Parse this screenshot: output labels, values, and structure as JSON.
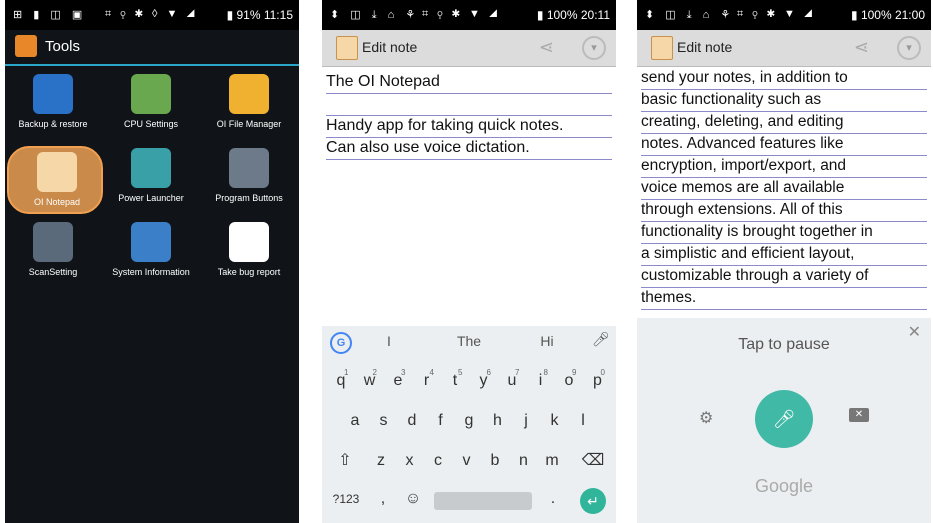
{
  "phone1": {
    "status": {
      "left_icons": "⊞ ▮ ◫ ▣",
      "mid_icons": "⌗ ⚲ ✱ ◊ ▼ ◢",
      "right": "▮ 91% 11:15"
    },
    "header_title": "Tools",
    "apps": [
      {
        "label": "Backup & restore",
        "color": "#2a71c8",
        "icon": "backup-restore-icon"
      },
      {
        "label": "CPU Settings",
        "color": "#6aa84f",
        "icon": "cpu-icon"
      },
      {
        "label": "OI File Manager",
        "color": "#f0b030",
        "icon": "folder-icon"
      },
      {
        "label": "OI Notepad",
        "color": "#f5d7a8",
        "icon": "notepad-icon",
        "selected": true
      },
      {
        "label": "Power Launcher",
        "color": "#3aa0a8",
        "icon": "power-launcher-icon"
      },
      {
        "label": "Program Buttons",
        "color": "#6c7a8a",
        "icon": "program-buttons-icon"
      },
      {
        "label": "ScanSetting",
        "color": "#5a6a7a",
        "icon": "scan-setting-icon"
      },
      {
        "label": "System Information",
        "color": "#3b7fc8",
        "icon": "info-icon"
      },
      {
        "label": "Take bug report",
        "color": "#ffffff",
        "icon": "bug-report-icon"
      }
    ]
  },
  "phone2": {
    "status": {
      "left_icons": "⬍ ◫ ⤓ ⌂ ⚘",
      "mid_icons": "⌗ ⚲ ✱ ▼ ◢",
      "right": "▮ 100% 20:11"
    },
    "header_title": "Edit note",
    "lines": [
      "The OI Notepad",
      "",
      "Handy app for taking quick notes.",
      "Can also use voice dictation."
    ],
    "suggestions": [
      "I",
      "The",
      "Hi"
    ],
    "row1": [
      {
        "k": "q",
        "n": "1"
      },
      {
        "k": "w",
        "n": "2"
      },
      {
        "k": "e",
        "n": "3"
      },
      {
        "k": "r",
        "n": "4"
      },
      {
        "k": "t",
        "n": "5"
      },
      {
        "k": "y",
        "n": "6"
      },
      {
        "k": "u",
        "n": "7"
      },
      {
        "k": "i",
        "n": "8"
      },
      {
        "k": "o",
        "n": "9"
      },
      {
        "k": "p",
        "n": "0"
      }
    ],
    "row2": [
      "a",
      "s",
      "d",
      "f",
      "g",
      "h",
      "j",
      "k",
      "l"
    ],
    "row3": [
      "z",
      "x",
      "c",
      "v",
      "b",
      "n",
      "m"
    ],
    "row4_left": "?123",
    "row4_comma": ",",
    "row4_period": "."
  },
  "phone3": {
    "status": {
      "left_icons": "⬍ ◫ ⤓ ⌂ ⚘",
      "mid_icons": "⌗ ⚲ ✱ ▼ ◢",
      "right": "▮ 100% 21:00"
    },
    "header_title": "Edit note",
    "lines": [
      "send your notes, in addition to",
      "basic functionality such as",
      "creating, deleting, and editing",
      "notes. Advanced features like",
      "encryption, import/export, and",
      "voice memos are all available",
      "through extensions. All of this",
      "functionality is brought together in",
      "a simplistic and efficient layout,",
      "customizable through a variety of",
      "themes."
    ],
    "voice_text": "Tap to pause",
    "voice_brand": "Google"
  }
}
